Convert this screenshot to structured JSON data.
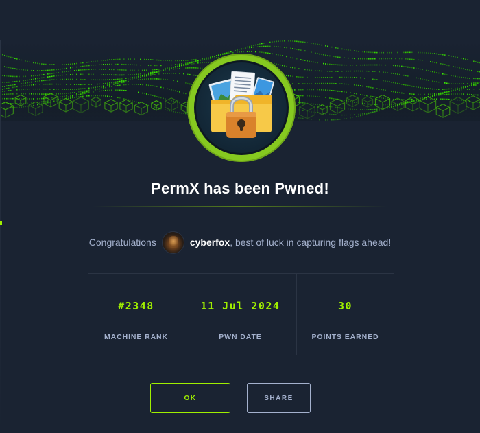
{
  "title": "PermX has been Pwned!",
  "congrats": {
    "prefix": "Congratulations",
    "username": "cyberfox",
    "suffix": ", best of luck in capturing flags ahead!"
  },
  "stats": [
    {
      "value": "#2348",
      "label": "MACHINE RANK"
    },
    {
      "value": "11 Jul 2024",
      "label": "PWN DATE"
    },
    {
      "value": "30",
      "label": "POINTS EARNED"
    }
  ],
  "buttons": {
    "ok": "OK",
    "share": "SHARE"
  },
  "icons": {
    "badge": "folder-lock-icon",
    "avatar": "user-avatar"
  },
  "colors": {
    "accent": "#9fef00",
    "background": "#1a2332",
    "border": "#2b3444",
    "muted_text": "#a4b1cd"
  }
}
